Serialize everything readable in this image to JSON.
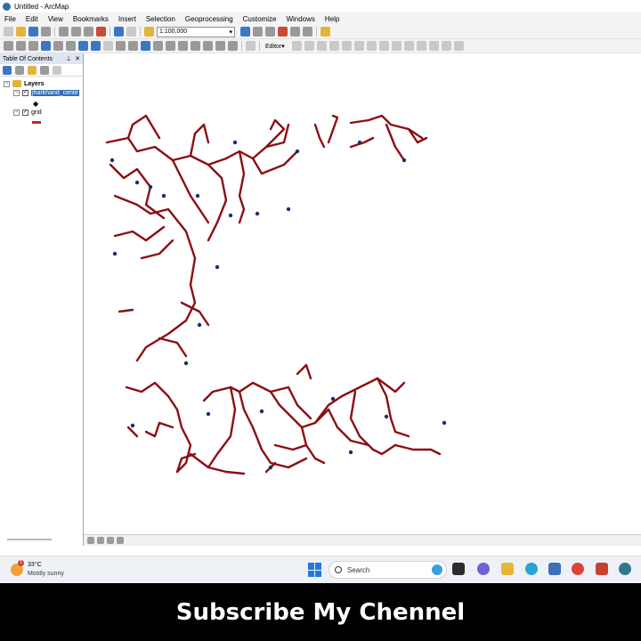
{
  "window": {
    "title": "Untitled - ArcMap"
  },
  "menu": [
    "File",
    "Edit",
    "View",
    "Bookmarks",
    "Insert",
    "Selection",
    "Geoprocessing",
    "Customize",
    "Windows",
    "Help"
  ],
  "toolbar": {
    "scale": "1:100,000",
    "editor_label": "Editor▾"
  },
  "toc": {
    "title": "Table Of Contents",
    "root_label": "Layers",
    "layers": [
      {
        "name": "jharkhand_cente",
        "checked": true,
        "selected": true,
        "symbol": "point",
        "symbol_color": "#000000"
      },
      {
        "name": "grid",
        "checked": true,
        "selected": false,
        "symbol": "line",
        "symbol_color": "#c0282a"
      }
    ]
  },
  "map": {
    "line_color": "#8b0f14",
    "point_color": "#1f2c6b"
  },
  "taskbar": {
    "weather_temp": "33°C",
    "weather_desc": "Mostly sunny",
    "weather_badge": "1",
    "search_label": "Search"
  },
  "banner": {
    "text": "Subscribe My Chennel"
  }
}
